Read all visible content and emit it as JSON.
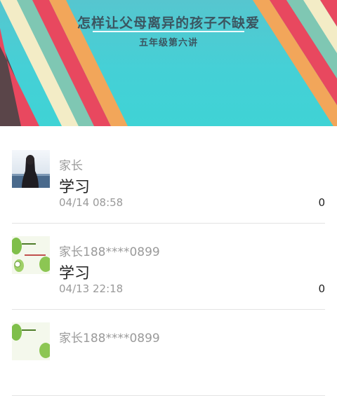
{
  "banner": {
    "title": "怎样让父母离异的孩子不缺爱",
    "subtitle": "五年级第六讲",
    "colors": {
      "background": "#45d0d6",
      "stripe_red": "#e8485f",
      "stripe_orange": "#f2a65a",
      "stripe_cream": "#f3ecc6",
      "stripe_teal": "#7fc7b3",
      "dark_corner": "#5a4549"
    }
  },
  "comments": [
    {
      "user": "家长",
      "text": "学习",
      "time": "04/14 08:58",
      "count": "0",
      "avatar": "photo-avatar"
    },
    {
      "user": "家长188****0899",
      "text": "学习",
      "time": "04/13 22:18",
      "count": "0",
      "avatar": "leaf-card-avatar"
    },
    {
      "user": "家长188****0899",
      "text": "",
      "time": "",
      "count": "",
      "avatar": "leaf-card-avatar"
    }
  ]
}
